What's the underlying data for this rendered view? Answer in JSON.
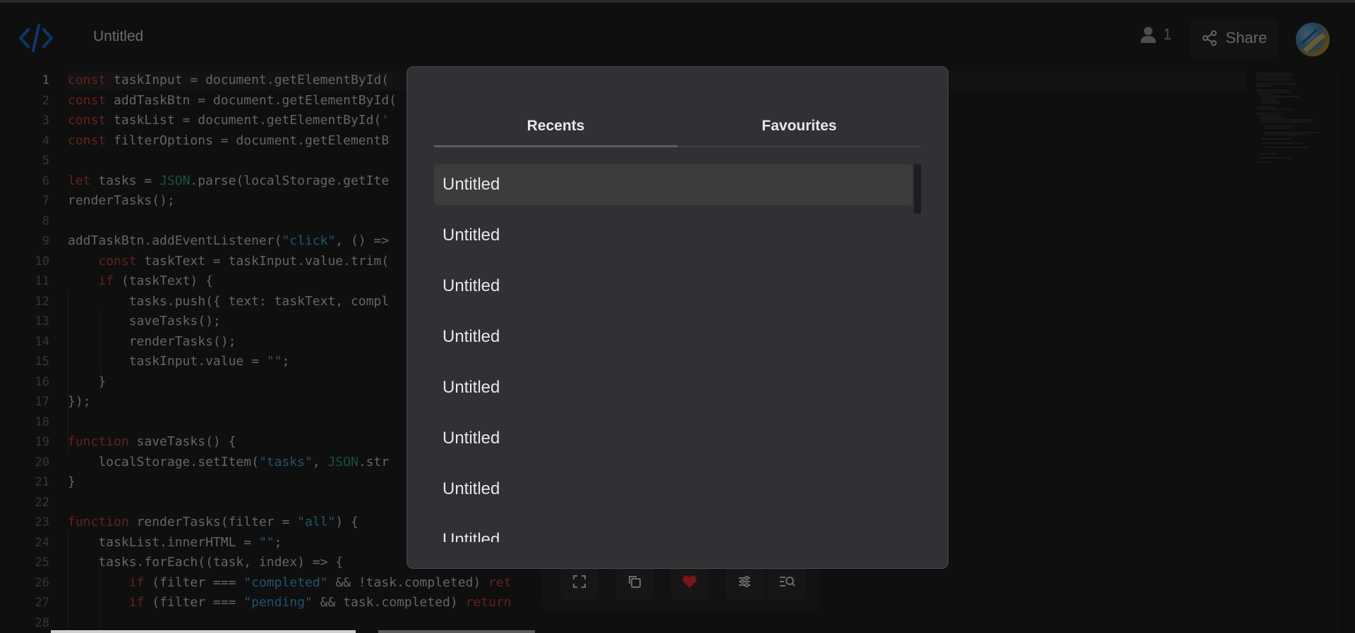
{
  "header": {
    "document_title": "Untitled",
    "user_count": "1",
    "share_label": "Share"
  },
  "editor": {
    "active_line": "1",
    "line_numbers": [
      "1",
      "2",
      "3",
      "4",
      "5",
      "6",
      "7",
      "8",
      "9",
      "10",
      "11",
      "12",
      "13",
      "14",
      "15",
      "16",
      "17",
      "18",
      "19",
      "20",
      "21",
      "22",
      "23",
      "24",
      "25",
      "26",
      "27",
      "28"
    ],
    "lines": [
      "const taskInput = document.getElementById(",
      "const addTaskBtn = document.getElementById(",
      "const taskList = document.getElementById('",
      "const filterOptions = document.getElementB",
      "",
      "let tasks = JSON.parse(localStorage.getIte",
      "renderTasks();",
      "",
      "addTaskBtn.addEventListener(\"click\", () =>",
      "    const taskText = taskInput.value.trim(",
      "    if (taskText) {",
      "        tasks.push({ text: taskText, compl",
      "        saveTasks();",
      "        renderTasks();",
      "        taskInput.value = \"\";",
      "    }",
      "});",
      "",
      "function saveTasks() {",
      "    localStorage.setItem(\"tasks\", JSON.str",
      "}",
      "",
      "function renderTasks(filter = \"all\") {",
      "    taskList.innerHTML = \"\";",
      "    tasks.forEach((task, index) => {",
      "        if (filter === \"completed\" && !task.completed) ret",
      "        if (filter === \"pending\" && task.completed) return",
      ""
    ]
  },
  "modal": {
    "tabs": [
      {
        "label": "Recents",
        "active": true
      },
      {
        "label": "Favourites",
        "active": false
      }
    ],
    "items": [
      "Untitled",
      "Untitled",
      "Untitled",
      "Untitled",
      "Untitled",
      "Untitled",
      "Untitled",
      "Untitled"
    ]
  },
  "toolbar": {
    "icons": [
      "fullscreen-icon",
      "copy-icon",
      "heart-icon",
      "sliders-icon",
      "search-list-icon"
    ]
  },
  "colors": {
    "accent_logo": "#1f6fd1",
    "heart": "#d11a1a",
    "modal_bg": "#303134"
  }
}
